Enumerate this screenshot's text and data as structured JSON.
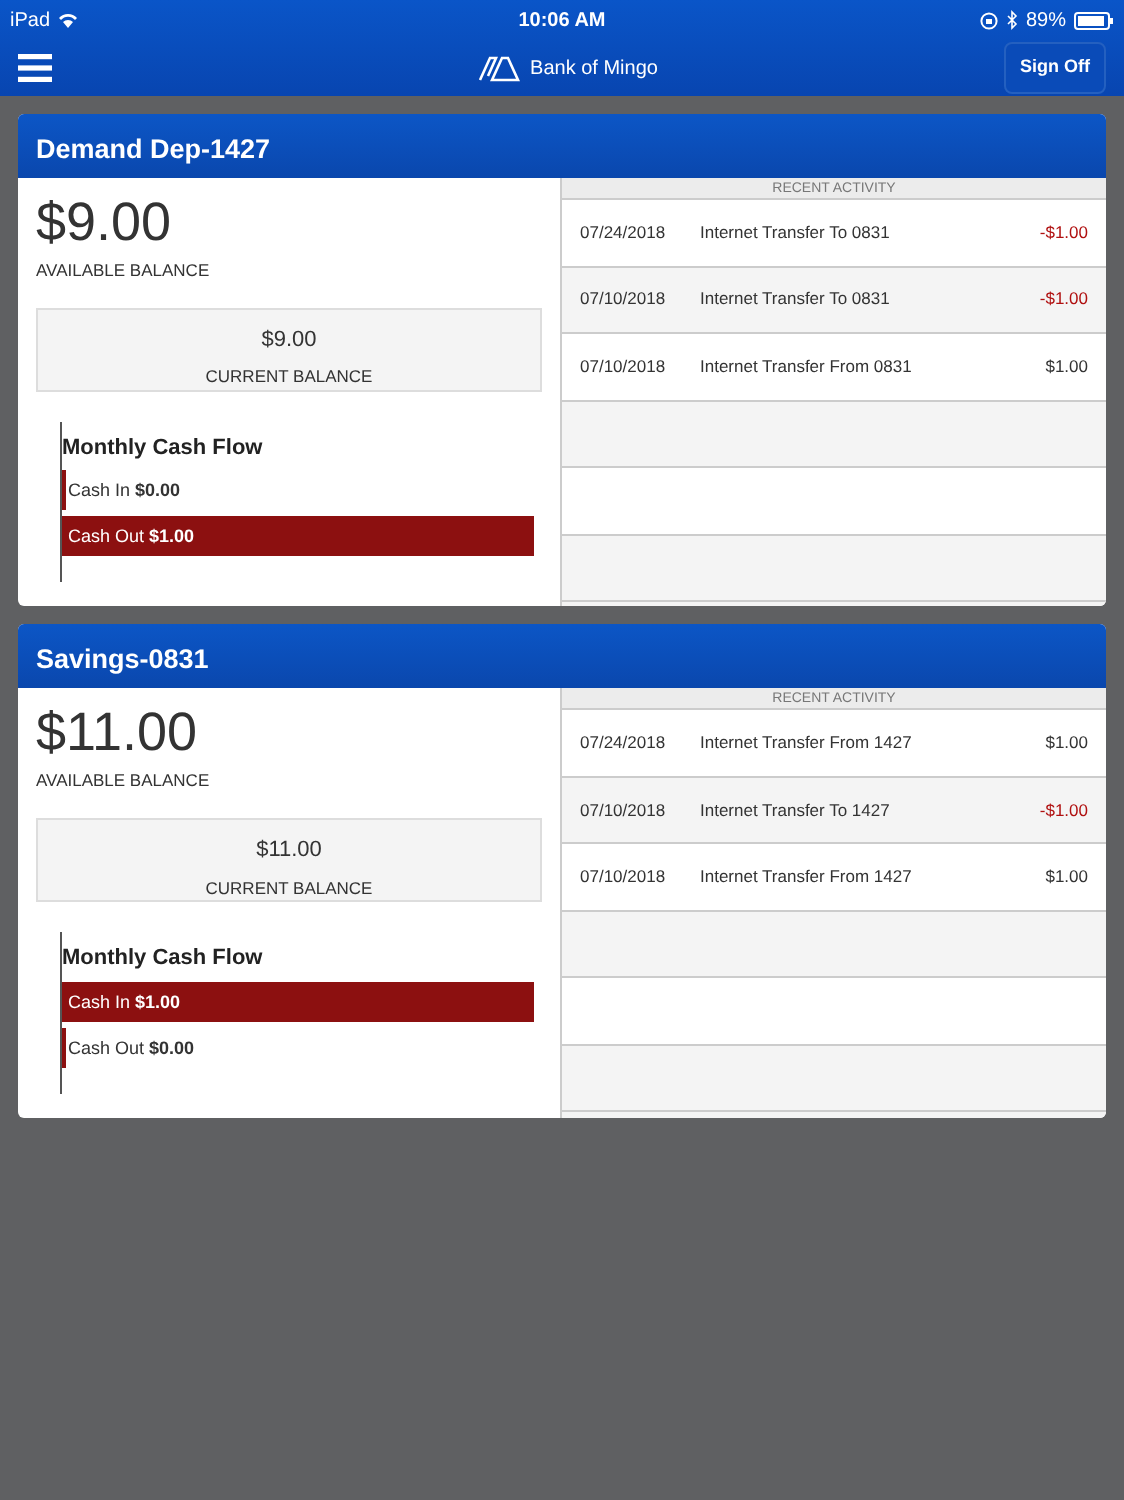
{
  "status_bar": {
    "device": "iPad",
    "time": "10:06 AM",
    "battery": "89%"
  },
  "navbar": {
    "brand": "Bank of Mingo",
    "button": "Sign Off"
  },
  "accounts": [
    {
      "title": "Demand Dep-1427",
      "available": "$9.00",
      "available_label": "AVAILABLE BALANCE",
      "current": "$9.00",
      "current_label": "CURRENT BALANCE",
      "cash_flow": {
        "title": "Monthly Cash Flow",
        "bars": [
          {
            "label": "Cash In",
            "amount": "$0.00",
            "level": 0
          },
          {
            "label": "Cash Out",
            "amount": "$1.00",
            "level": 1
          }
        ]
      },
      "activity_title": "RECENT ACTIVITY",
      "activity": [
        {
          "date": "07/24/2018",
          "description": "Internet Transfer To 0831",
          "amount": "-$1.00",
          "kind": "debit"
        },
        {
          "date": "07/10/2018",
          "description": "Internet Transfer To 0831",
          "amount": "-$1.00",
          "kind": "debit"
        },
        {
          "date": "07/10/2018",
          "description": "Internet Transfer From 0831",
          "amount": "$1.00",
          "kind": "credit"
        }
      ]
    },
    {
      "title": "Savings-0831",
      "available": "$11.00",
      "available_label": "AVAILABLE BALANCE",
      "current": "$11.00",
      "current_label": "CURRENT BALANCE",
      "cash_flow": {
        "title": "Monthly Cash Flow",
        "bars": [
          {
            "label": "Cash In",
            "amount": "$1.00",
            "level": 1
          },
          {
            "label": "Cash Out",
            "amount": "$0.00",
            "level": 0
          }
        ]
      },
      "activity_title": "RECENT ACTIVITY",
      "activity": [
        {
          "date": "07/24/2018",
          "description": "Internet Transfer From 1427",
          "amount": "$1.00",
          "kind": "credit"
        },
        {
          "date": "07/10/2018",
          "description": "Internet Transfer To 1427",
          "amount": "-$1.00",
          "kind": "debit"
        },
        {
          "date": "07/10/2018",
          "description": "Internet Transfer From 1427",
          "amount": "$1.00",
          "kind": "credit"
        }
      ]
    }
  ]
}
